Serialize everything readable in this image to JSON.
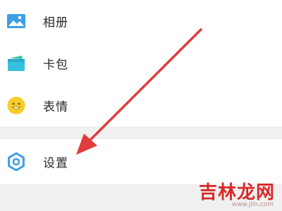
{
  "menu": {
    "items": [
      {
        "label": "相册",
        "icon": "photo-album-icon"
      },
      {
        "label": "卡包",
        "icon": "card-wallet-icon"
      },
      {
        "label": "表情",
        "icon": "emoji-smile-icon"
      },
      {
        "label": "设置",
        "icon": "settings-gear-icon"
      }
    ]
  },
  "watermark": {
    "text": "吉林龙网",
    "sub": "www.jlln.com"
  },
  "colors": {
    "arrow": "#e23b3b",
    "section_gap": "#f0f0f0",
    "photo_icon": "#3d9fe6",
    "card_icon": "#2ec4a8",
    "emoji_icon": "#f6cc2a",
    "gear_icon": "#3aa0e8"
  }
}
